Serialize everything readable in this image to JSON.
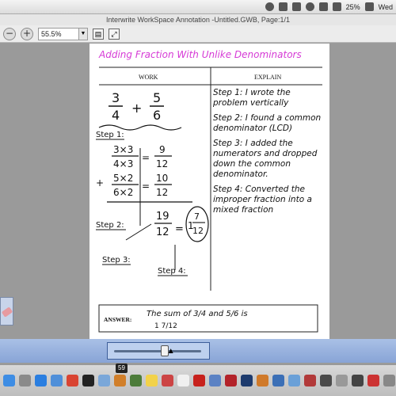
{
  "menubar": {
    "battery": "25%",
    "day": "Wed"
  },
  "window": {
    "title": "Interwrite WorkSpace Annotation -Untitled.GWB, Page:1/1"
  },
  "toolbar": {
    "zoom_out": "−",
    "zoom_in": "+",
    "zoom_value": "55.5%"
  },
  "sheet": {
    "title": "Adding Fraction With Unlike Denominators",
    "col_work": "WORK",
    "col_explain": "EXPLAIN",
    "problem": {
      "a_num": "3",
      "a_den": "4",
      "op": "+",
      "b_num": "5",
      "b_den": "6"
    },
    "step1_label": "Step 1:",
    "work_lines": [
      {
        "num": "3×3",
        "den": "4×3",
        "rnum": "9",
        "rden": "12"
      },
      {
        "num": "5×2",
        "den": "6×2",
        "rnum": "10",
        "rden": "12"
      }
    ],
    "plus": "+",
    "step2_label": "Step 2:",
    "sum_num": "19",
    "sum_den": "12",
    "mixed_whole": "1",
    "mixed_num": "7",
    "mixed_den": "12",
    "step3_label": "Step 3:",
    "step4_label": "Step 4:",
    "explain": [
      "Step 1: I wrote the problem vertically",
      "Step 2: I found a common denominator (LCD)",
      "Step 3: I added the numerators and dropped down the common denominator.",
      "Step 4: Converted the improper fraction into a mixed fraction"
    ],
    "answer_label": "ANSWER:",
    "answer_text": "The sum of 3/4 and 5/6 is",
    "answer_value": "1 7/12"
  },
  "slider": {
    "position": 0.58
  },
  "dock": {
    "tooltip": "59",
    "icons": [
      {
        "name": "finder-icon",
        "color": "#3e8de4"
      },
      {
        "name": "launchpad-icon",
        "color": "#8a8a8a"
      },
      {
        "name": "safari-icon",
        "color": "#2a7ee0"
      },
      {
        "name": "mail-icon",
        "color": "#4f8fd9"
      },
      {
        "name": "chrome-icon",
        "color": "#d94432"
      },
      {
        "name": "quicktime-icon",
        "color": "#222222"
      },
      {
        "name": "preview-icon",
        "color": "#7aa7d9"
      },
      {
        "name": "app-icon",
        "color": "#d17f2a"
      },
      {
        "name": "app-icon",
        "color": "#4c7c3a"
      },
      {
        "name": "notes-icon",
        "color": "#f2d24a"
      },
      {
        "name": "app-icon",
        "color": "#c44"
      },
      {
        "name": "calendar-icon",
        "color": "#f0f0f0"
      },
      {
        "name": "acrobat-icon",
        "color": "#c7211c"
      },
      {
        "name": "app-icon",
        "color": "#5b82c4"
      },
      {
        "name": "flash-icon",
        "color": "#b3232a"
      },
      {
        "name": "photoshop-icon",
        "color": "#1d3b6e"
      },
      {
        "name": "app-icon",
        "color": "#d07a2a"
      },
      {
        "name": "app-icon",
        "color": "#3b6fb6"
      },
      {
        "name": "app-icon",
        "color": "#6aa0d8"
      },
      {
        "name": "app-icon",
        "color": "#b23a3a"
      },
      {
        "name": "app-icon",
        "color": "#4a4a4a"
      },
      {
        "name": "app-icon",
        "color": "#999999"
      },
      {
        "name": "app-icon",
        "color": "#444444"
      },
      {
        "name": "app-icon",
        "color": "#c33"
      },
      {
        "name": "app-icon",
        "color": "#888888"
      }
    ]
  },
  "colors": {
    "title_pink": "#d63ad6",
    "ink": "#111111"
  }
}
